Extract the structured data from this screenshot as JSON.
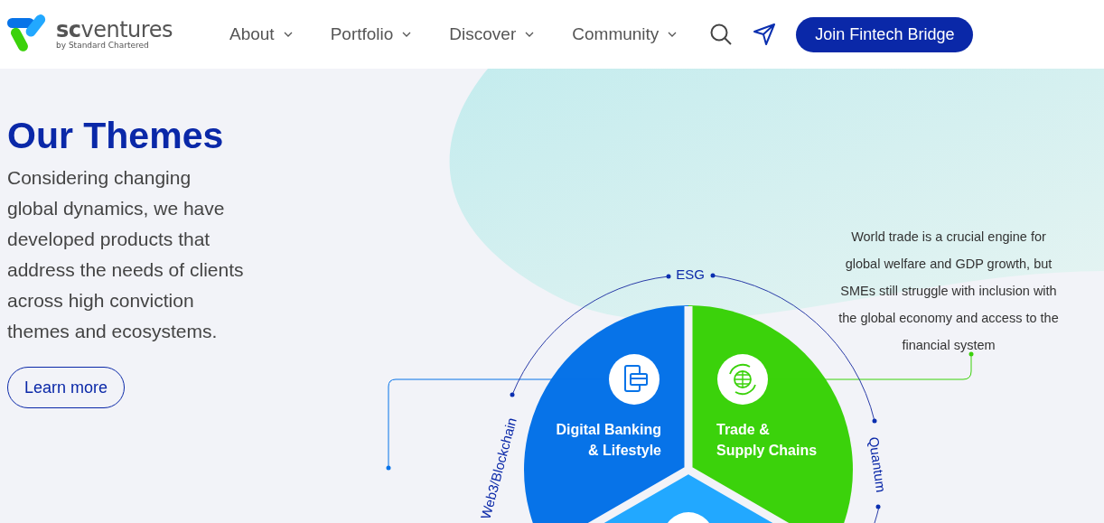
{
  "header": {
    "logo": {
      "brand_bold": "sc",
      "brand_rest": "ventures",
      "tagline": "by Standard Chartered"
    },
    "nav": [
      {
        "label": "About"
      },
      {
        "label": "Portfolio"
      },
      {
        "label": "Discover"
      },
      {
        "label": "Community"
      }
    ],
    "cta": "Join Fintech Bridge"
  },
  "hero": {
    "title": "Our Themes",
    "description": "Considering changing global dynamics, we have developed products that address the needs of clients across high conviction themes and ecosystems.",
    "button": "Learn more"
  },
  "diagram": {
    "segments": [
      {
        "kind": "banking",
        "lines": [
          "Digital Banking",
          "& Lifestyle"
        ],
        "color": "#0773e8"
      },
      {
        "kind": "trade",
        "lines": [
          "Trade &",
          "Supply Chains"
        ],
        "color": "#3bd20b"
      },
      {
        "kind": "bottom",
        "color": "#22a8ff"
      }
    ],
    "ring_labels": [
      "ESG",
      "Web3/Blockchain",
      "Quantum"
    ],
    "callout": [
      "World trade is a crucial engine for",
      "global welfare and GDP growth, but",
      "SMEs still struggle with inclusion with",
      "the global economy and access to the",
      "financial system"
    ]
  }
}
